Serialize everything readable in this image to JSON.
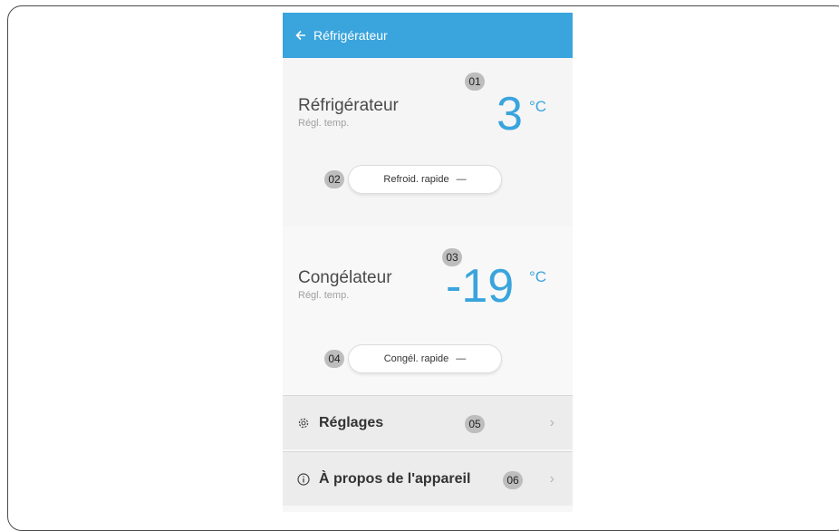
{
  "appbar": {
    "title": "Réfrigérateur",
    "back_icon": "arrow-left-icon"
  },
  "fridge": {
    "name": "Réfrigérateur",
    "subtitle": "Régl. temp.",
    "temperature": "3",
    "unit": "°C",
    "badge": "01",
    "quick_button": {
      "label": "Refroid. rapide",
      "state": "—",
      "badge": "02"
    }
  },
  "freezer": {
    "name": "Congélateur",
    "subtitle": "Régl. temp.",
    "temperature": "-19",
    "unit": "°C",
    "badge": "03",
    "quick_button": {
      "label": "Congél. rapide",
      "state": "—",
      "badge": "04"
    }
  },
  "menu": [
    {
      "label": "Réglages",
      "icon": "gear-icon",
      "badge": "05"
    },
    {
      "label": "À propos de l'appareil",
      "icon": "info-icon",
      "badge": "06"
    }
  ],
  "colors": {
    "accent": "#3aa4dd",
    "badge": "#bdbdbd"
  }
}
